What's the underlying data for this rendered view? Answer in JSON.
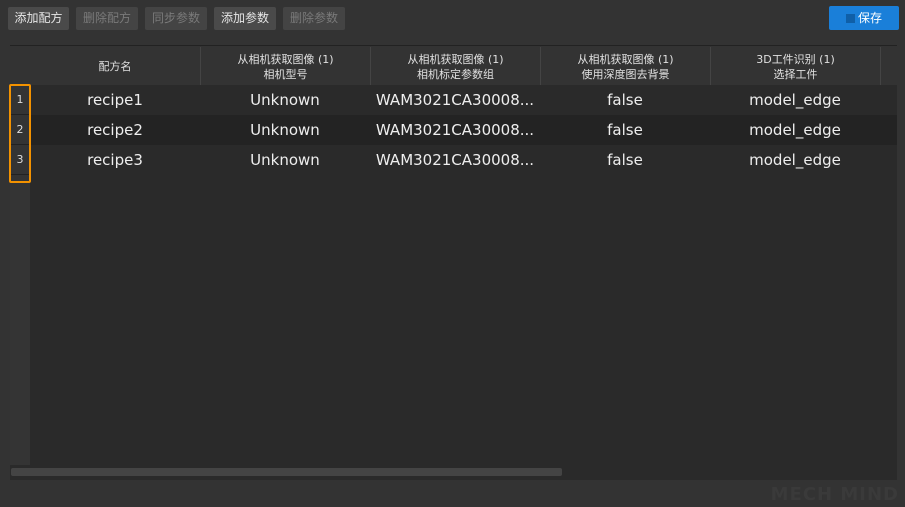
{
  "toolbar": {
    "add_recipe": "添加配方",
    "delete_recipe": "删除配方",
    "sync_params": "同步参数",
    "add_param": "添加参数",
    "delete_param": "删除参数",
    "save": "保存"
  },
  "columns": [
    {
      "line1": "",
      "line2": "配方名"
    },
    {
      "line1": "从相机获取图像 (1)",
      "line2": "相机型号"
    },
    {
      "line1": "从相机获取图像 (1)",
      "line2": "相机标定参数组"
    },
    {
      "line1": "从相机获取图像 (1)",
      "line2": "使用深度图去背景"
    },
    {
      "line1": "3D工件识别 (1)",
      "line2": "选择工件"
    }
  ],
  "rows": [
    {
      "num": "1",
      "cells": [
        "recipe1",
        "Unknown",
        "WAM3021CA30008...",
        "false",
        "model_edge"
      ]
    },
    {
      "num": "2",
      "cells": [
        "recipe2",
        "Unknown",
        "WAM3021CA30008...",
        "false",
        "model_edge"
      ]
    },
    {
      "num": "3",
      "cells": [
        "recipe3",
        "Unknown",
        "WAM3021CA30008...",
        "false",
        "model_edge"
      ]
    }
  ],
  "watermark": "MECH MIND",
  "colors": {
    "accent": "#1a7fd9",
    "selection": "#f39200"
  }
}
